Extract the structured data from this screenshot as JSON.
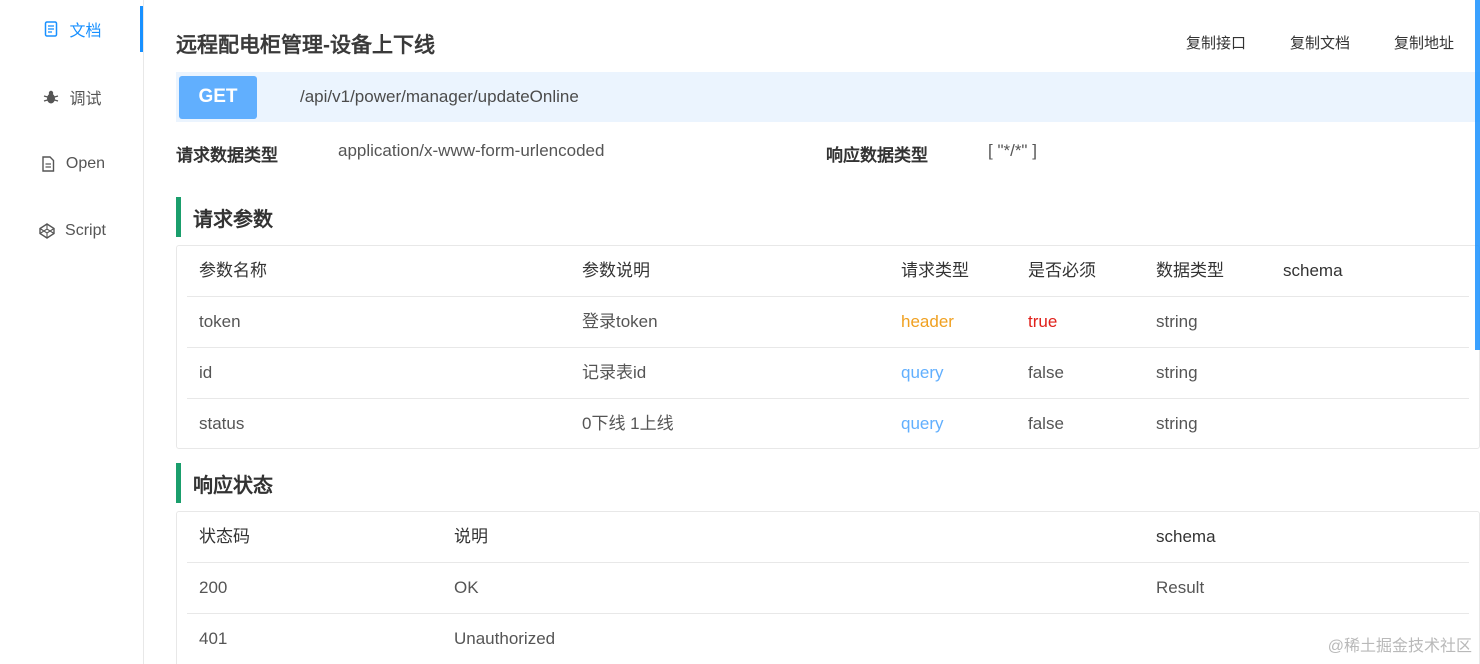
{
  "sidebar": {
    "items": [
      {
        "label": "文档",
        "icon": "document-icon",
        "active": true
      },
      {
        "label": "调试",
        "icon": "bug-icon",
        "active": false
      },
      {
        "label": "Open",
        "icon": "file-icon",
        "active": false
      },
      {
        "label": "Script",
        "icon": "codepen-icon",
        "active": false
      }
    ]
  },
  "header": {
    "title": "远程配电柜管理-设备上下线",
    "actions": [
      "复制接口",
      "复制文档",
      "复制地址"
    ]
  },
  "request": {
    "method": "GET",
    "url": "/api/v1/power/manager/updateOnline",
    "req_type_label": "请求数据类型",
    "req_type_value": "application/x-www-form-urlencoded",
    "resp_type_label": "响应数据类型",
    "resp_type_value": "[ \"*/*\" ]"
  },
  "params": {
    "title": "请求参数",
    "columns": [
      "参数名称",
      "参数说明",
      "请求类型",
      "是否必须",
      "数据类型",
      "schema"
    ],
    "rows": [
      {
        "name": "token",
        "desc": "登录token",
        "in": "header",
        "required": "true",
        "type": "string",
        "schema": ""
      },
      {
        "name": "id",
        "desc": "记录表id",
        "in": "query",
        "required": "false",
        "type": "string",
        "schema": ""
      },
      {
        "name": "status",
        "desc": "0下线 1上线",
        "in": "query",
        "required": "false",
        "type": "string",
        "schema": ""
      }
    ]
  },
  "responses": {
    "title": "响应状态",
    "columns": [
      "状态码",
      "说明",
      "schema"
    ],
    "rows": [
      {
        "code": "200",
        "desc": "OK",
        "schema": "Result"
      },
      {
        "code": "401",
        "desc": "Unauthorized",
        "schema": ""
      }
    ]
  },
  "watermark": "@稀土掘金技术社区",
  "colors": {
    "accent": "#1890ff",
    "get_method": "#61affe",
    "url_bar_bg": "#ebf4fe",
    "section_bar": "#1a9e6c",
    "header_in": "#f0a020",
    "required_true": "#e0201a",
    "query_in": "#61affe"
  }
}
